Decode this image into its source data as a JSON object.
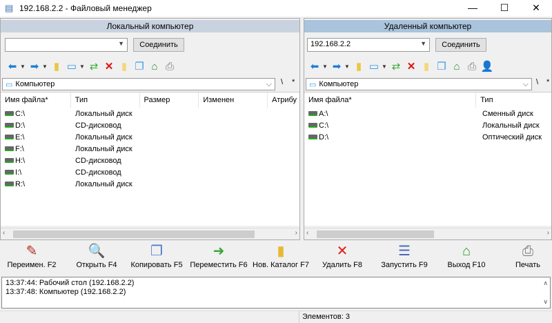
{
  "window": {
    "title": "192.168.2.2 - Файловый менеджер",
    "minimize": "—",
    "maximize": "☐",
    "close": "✕"
  },
  "local": {
    "header": "Локальный компьютер",
    "address": "",
    "connect": "Соединить",
    "path": "Компьютер",
    "root": "\\",
    "star": "*",
    "columns": [
      "Имя файла*",
      "Тип",
      "Размер",
      "Изменен",
      "Атрибу"
    ],
    "rows": [
      {
        "name": "C:\\",
        "type": "Локальный диск",
        "icon": "windows-drive"
      },
      {
        "name": "D:\\",
        "type": "CD-дисковод",
        "icon": "cd-drive"
      },
      {
        "name": "E:\\",
        "type": "Локальный диск",
        "icon": "drive"
      },
      {
        "name": "F:\\",
        "type": "Локальный диск",
        "icon": "drive"
      },
      {
        "name": "H:\\",
        "type": "CD-дисковод",
        "icon": "cd-drive"
      },
      {
        "name": "I:\\",
        "type": "CD-дисковод",
        "icon": "cd-drive"
      },
      {
        "name": "R:\\",
        "type": "Локальный диск",
        "icon": "drive"
      }
    ]
  },
  "remote": {
    "header": "Удаленный компьютер",
    "address": "192.168.2.2",
    "connect": "Соединить",
    "path": "Компьютер",
    "root": "\\",
    "star": "*",
    "columns": [
      "Имя файла*",
      "Тип"
    ],
    "rows": [
      {
        "name": "A:\\",
        "type": "Сменный диск",
        "icon": "floppy-drive"
      },
      {
        "name": "C:\\",
        "type": "Локальный диск",
        "icon": "drive"
      },
      {
        "name": "D:\\",
        "type": "Оптический диск",
        "icon": "cd-drive"
      }
    ]
  },
  "fkeys": [
    "Переимен. F2",
    "Открыть F4",
    "Копировать F5",
    "Переместить F6",
    "Нов. Каталог F7",
    "Удалить F8",
    "Запустить F9",
    "Выход F10",
    "Печать"
  ],
  "log": [
    "13:37:44: Рабочий стол   (192.168.2.2)",
    "13:37:48: Компьютер   (192.168.2.2)"
  ],
  "status": "Элементов: 3",
  "colors": {
    "local_header": "#c9d3df",
    "remote_header": "#a9c4dc",
    "arrow": "#1e7fd6",
    "delete": "#e01010"
  }
}
